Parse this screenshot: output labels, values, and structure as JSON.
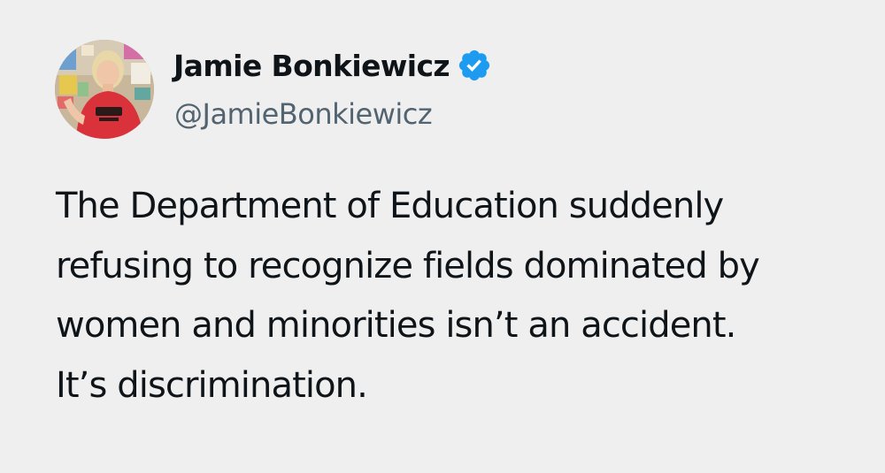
{
  "author": {
    "display_name": "Jamie Bonkiewicz",
    "handle": "@JamieBonkiewicz",
    "verified": true,
    "verified_icon": "verified-badge-icon",
    "avatar": "profile-photo"
  },
  "tweet": {
    "lines": [
      "The Department of Education suddenly",
      "refusing to recognize fields dominated by",
      "women and minorities isn’t an accident.",
      "It’s discrimination."
    ]
  },
  "colors": {
    "background": "#efefef",
    "text": "#0f1419",
    "handle": "#536471",
    "verified": "#1d9bf0"
  }
}
